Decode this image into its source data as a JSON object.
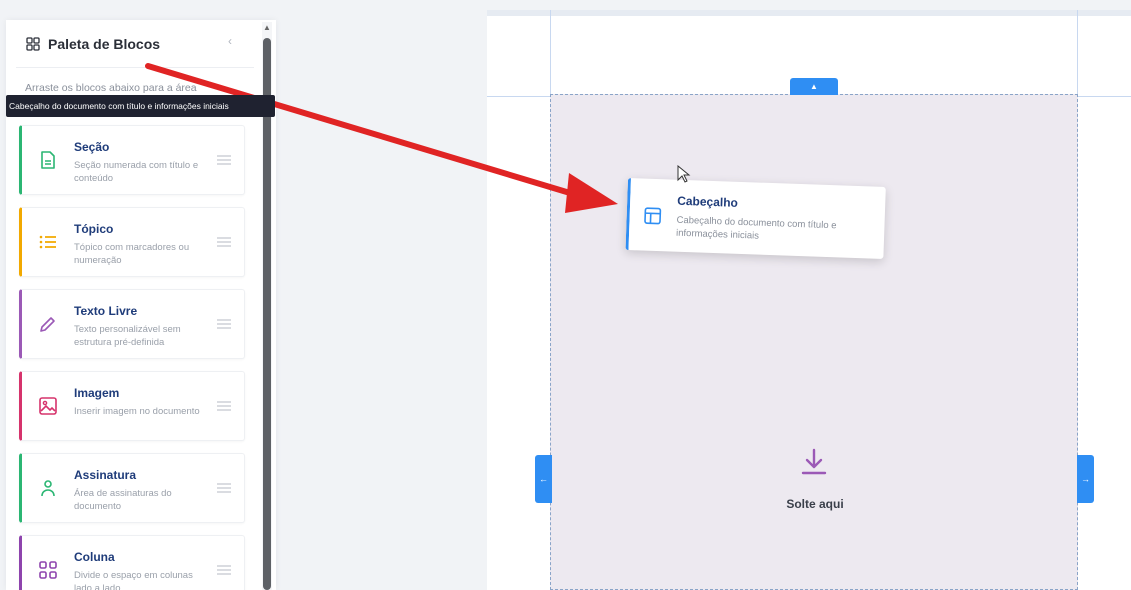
{
  "sidebar": {
    "title": "Paleta de Blocos",
    "hint": "Arraste os blocos abaixo para a área",
    "tooltip": "Cabeçalho do documento com título e informações iniciais",
    "blocks": [
      {
        "title": "Seção",
        "description": "Seção numerada com título e conteúdo",
        "icon": "document-icon",
        "color": "#2bb673"
      },
      {
        "title": "Tópico",
        "description": "Tópico com marcadores ou numeração",
        "icon": "list-icon",
        "color": "#f2a900"
      },
      {
        "title": "Texto Livre",
        "description": "Texto personalizável sem estrutura pré-definida",
        "icon": "pencil-icon",
        "color": "#9b59b6"
      },
      {
        "title": "Imagem",
        "description": "Inserir imagem no documento",
        "icon": "image-icon",
        "color": "#d6336c"
      },
      {
        "title": "Assinatura",
        "description": "Área de assinaturas do documento",
        "icon": "user-icon",
        "color": "#2bb673"
      },
      {
        "title": "Coluna",
        "description": "Divide o espaço em colunas lado a lado",
        "icon": "grid-icon",
        "color": "#8e44ad"
      }
    ]
  },
  "canvas": {
    "drop_label": "Solte aqui",
    "dragged_block": {
      "title": "Cabeçalho",
      "description": "Cabeçalho do documento com título e informações iniciais",
      "icon": "layout-icon",
      "color": "#2f8ef3"
    }
  },
  "annotation": {
    "arrow_color": "#e02424"
  }
}
